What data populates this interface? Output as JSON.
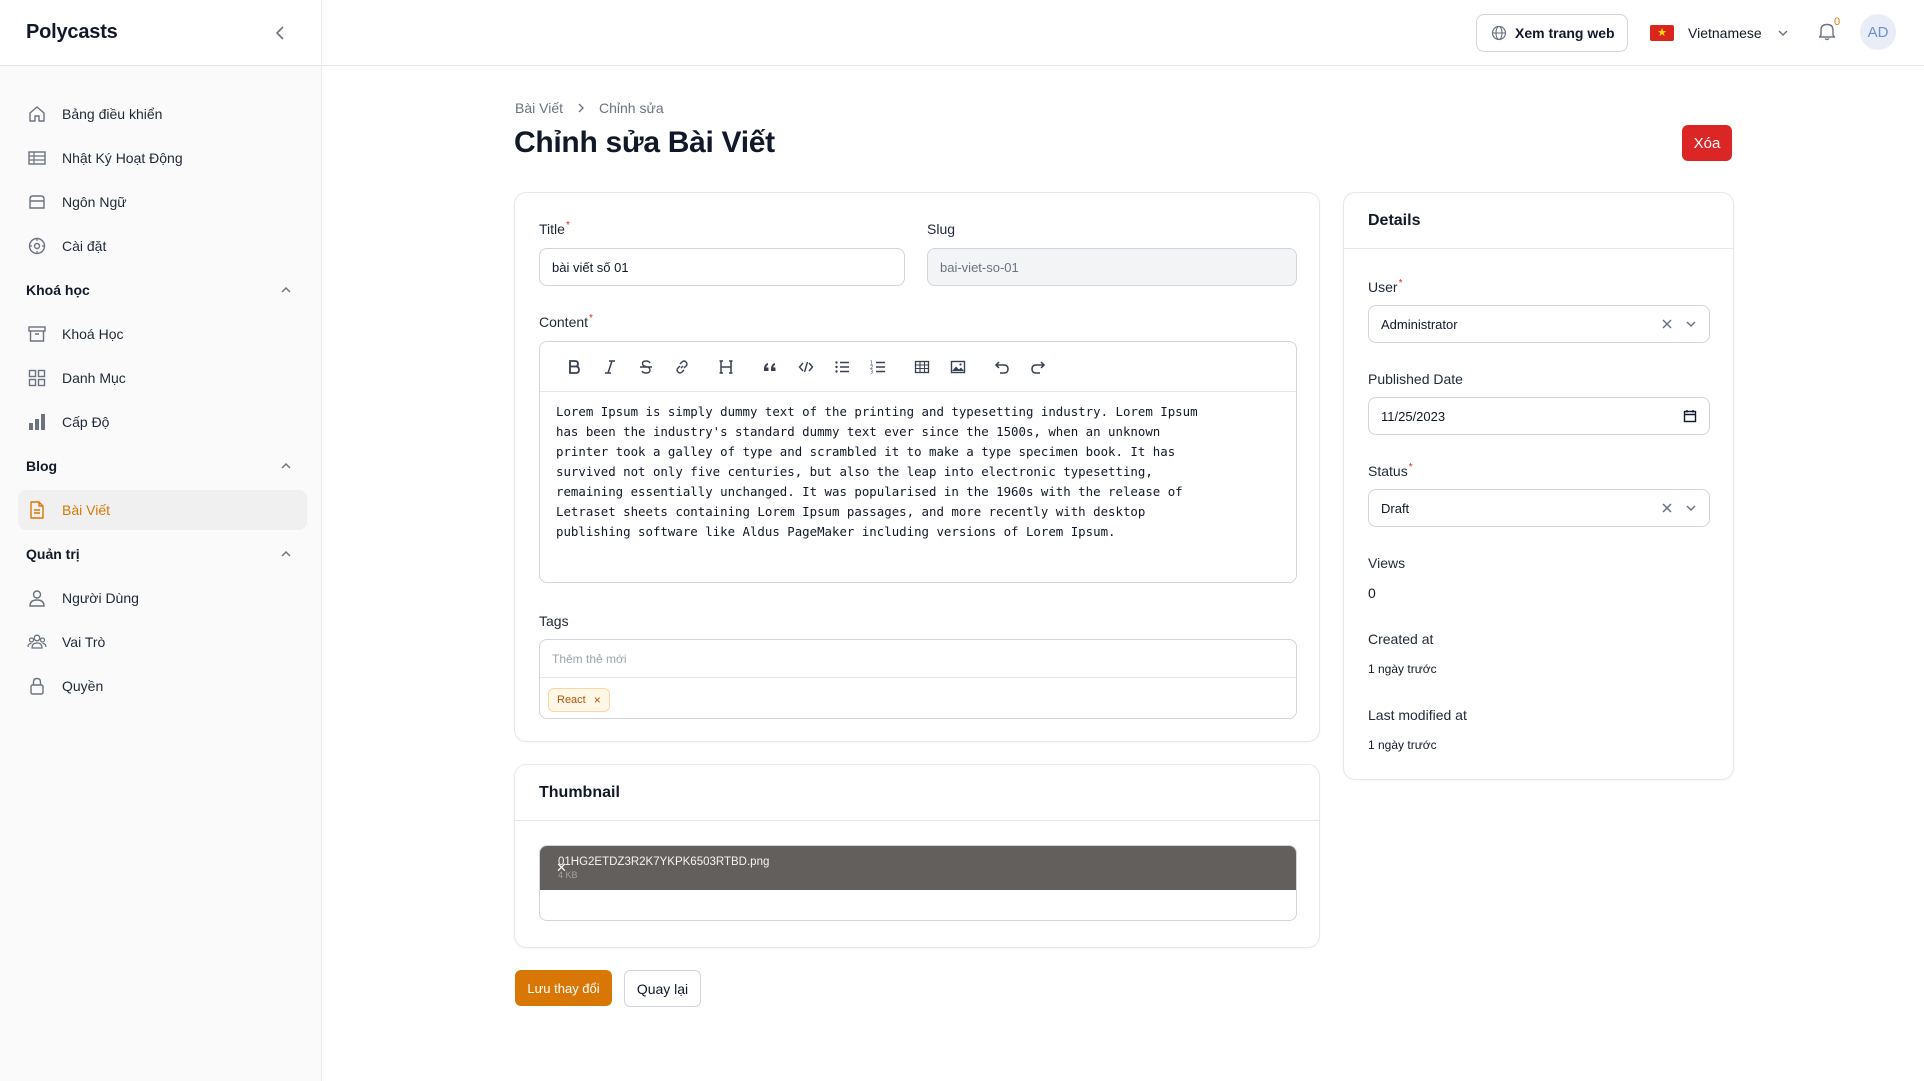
{
  "app": {
    "brand": "Polycasts"
  },
  "sidebar": {
    "items_top": [
      {
        "label": "Bảng điều khiển",
        "icon": "home-icon"
      },
      {
        "label": "Nhật Ký Hoạt Động",
        "icon": "table-icon"
      },
      {
        "label": "Ngôn Ngữ",
        "icon": "inbox-icon"
      },
      {
        "label": "Cài đặt",
        "icon": "settings-icon"
      }
    ],
    "groups": [
      {
        "label": "Khoá học",
        "items": [
          {
            "label": "Khoá Học",
            "icon": "archive-icon"
          },
          {
            "label": "Danh Mục",
            "icon": "grid-icon"
          },
          {
            "label": "Cấp Độ",
            "icon": "bar-chart-icon"
          }
        ]
      },
      {
        "label": "Blog",
        "items": [
          {
            "label": "Bài Viết",
            "icon": "document-icon",
            "active": true
          }
        ]
      },
      {
        "label": "Quản trị",
        "items": [
          {
            "label": "Người Dùng",
            "icon": "user-icon"
          },
          {
            "label": "Vai Trò",
            "icon": "users-icon"
          },
          {
            "label": "Quyền",
            "icon": "lock-icon"
          }
        ]
      }
    ]
  },
  "topbar": {
    "view_site": "Xem trang web",
    "language": "Vietnamese",
    "notification_count": "0",
    "avatar_initials": "AD"
  },
  "breadcrumb": {
    "parent": "Bài Viết",
    "current": "Chỉnh sửa"
  },
  "page": {
    "title": "Chỉnh sửa Bài Viết",
    "delete_label": "Xóa"
  },
  "form": {
    "title_label": "Title",
    "title_value": "bài viết số 01",
    "slug_label": "Slug",
    "slug_value": "bai-viet-so-01",
    "content_label": "Content",
    "content_value": "Lorem Ipsum is simply dummy text of the printing and typesetting industry. Lorem Ipsum\nhas been the industry's standard dummy text ever since the 1500s, when an unknown\nprinter took a galley of type and scrambled it to make a type specimen book. It has\nsurvived not only five centuries, but also the leap into electronic typesetting,\nremaining essentially unchanged. It was popularised in the 1960s with the release of\nLetraset sheets containing Lorem Ipsum passages, and more recently with desktop\npublishing software like Aldus PageMaker including versions of Lorem Ipsum.",
    "tags_label": "Tags",
    "tags_placeholder": "Thêm thẻ mới",
    "tags": [
      "React"
    ]
  },
  "thumbnail": {
    "heading": "Thumbnail",
    "file_name": "01HG2ETDZ3R2K7YKPK6503RTBD.png",
    "file_size": "4 KB"
  },
  "actions": {
    "save": "Lưu thay đổi",
    "back": "Quay lại"
  },
  "details": {
    "heading": "Details",
    "user_label": "User",
    "user_value": "Administrator",
    "published_label": "Published Date",
    "published_value": "11/25/2023",
    "status_label": "Status",
    "status_value": "Draft",
    "views_label": "Views",
    "views_value": "0",
    "created_label": "Created at",
    "created_value": "1 ngày trước",
    "modified_label": "Last modified at",
    "modified_value": "1 ngày trước"
  },
  "colors": {
    "accent": "#d97706",
    "danger": "#dc2626"
  }
}
